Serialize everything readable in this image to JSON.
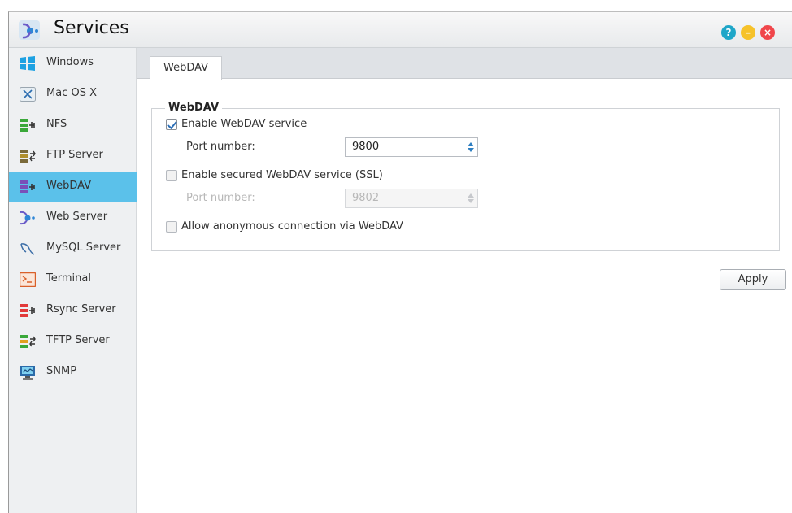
{
  "window": {
    "title": "Services",
    "buttons": {
      "help": "?",
      "minimize": "–",
      "close": "×"
    }
  },
  "sidebar": {
    "items": [
      {
        "label": "Windows",
        "icon": "windows-icon"
      },
      {
        "label": "Mac OS X",
        "icon": "mac-os-x-icon"
      },
      {
        "label": "NFS",
        "icon": "nfs-icon"
      },
      {
        "label": "FTP Server",
        "icon": "ftp-server-icon"
      },
      {
        "label": "WebDAV",
        "icon": "webdav-icon",
        "active": true
      },
      {
        "label": "Web Server",
        "icon": "web-server-icon"
      },
      {
        "label": "MySQL Server",
        "icon": "mysql-server-icon"
      },
      {
        "label": "Terminal",
        "icon": "terminal-icon"
      },
      {
        "label": "Rsync Server",
        "icon": "rsync-server-icon"
      },
      {
        "label": "TFTP Server",
        "icon": "tftp-server-icon"
      },
      {
        "label": "SNMP",
        "icon": "snmp-icon"
      }
    ]
  },
  "main": {
    "tab_label": "WebDAV",
    "group": {
      "legend": "WebDAV",
      "enable_label": "Enable WebDAV service",
      "enable_checked": true,
      "port_label": "Port number:",
      "port_value": "9800",
      "ssl_label": "Enable secured WebDAV service (SSL)",
      "ssl_checked": false,
      "ssl_port_label": "Port number:",
      "ssl_port_value": "9802",
      "anon_label": "Allow anonymous connection via WebDAV",
      "anon_checked": false
    },
    "apply_label": "Apply"
  },
  "colors": {
    "accent": "#5bc1ea",
    "help": "#1ea6c8",
    "minimize": "#f6c22a",
    "close": "#f0464b"
  }
}
